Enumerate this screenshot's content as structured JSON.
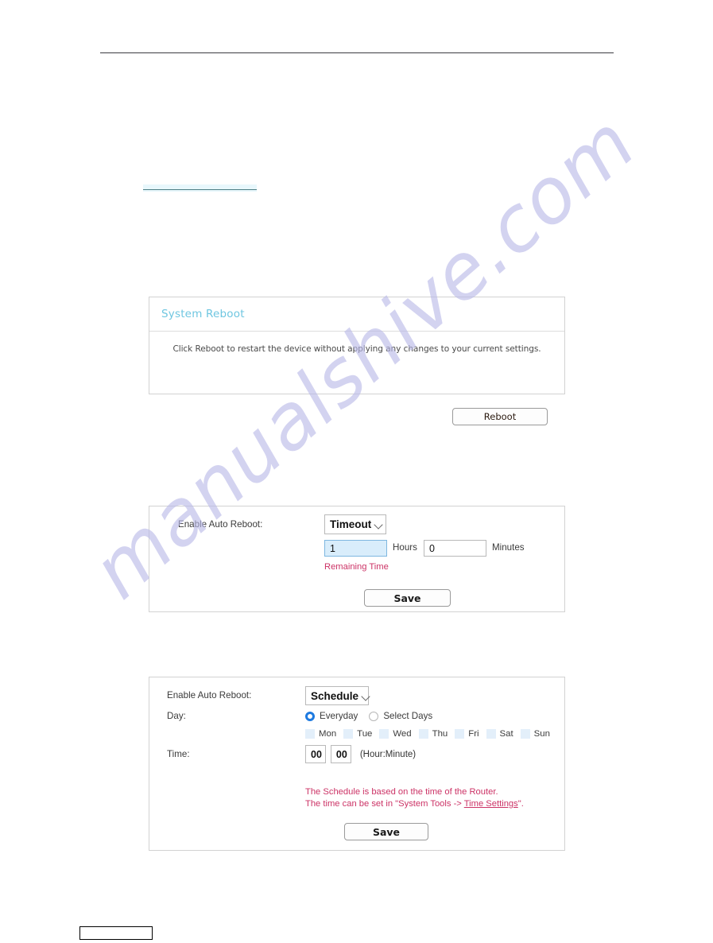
{
  "watermark": {
    "text": "manualshive.com"
  },
  "panels": {
    "system_reboot": {
      "title": "System Reboot",
      "description": "Click Reboot to restart the device without applying any changes to your current settings.",
      "reboot_button": "Reboot"
    },
    "auto_reboot_timeout": {
      "enable_label": "Enable Auto Reboot:",
      "mode": "Timeout",
      "hours_value": "1",
      "hours_unit": "Hours",
      "minutes_value": "0",
      "minutes_unit": "Minutes",
      "remaining_time": "Remaining Time",
      "save_button": "Save"
    },
    "auto_reboot_schedule": {
      "enable_label": "Enable Auto Reboot:",
      "mode": "Schedule",
      "day_label": "Day:",
      "everyday_label": "Everyday",
      "select_days_label": "Select Days",
      "selected_day_mode": "Everyday",
      "days": [
        {
          "label": "Mon",
          "checked": false
        },
        {
          "label": "Tue",
          "checked": false
        },
        {
          "label": "Wed",
          "checked": false
        },
        {
          "label": "Thu",
          "checked": false
        },
        {
          "label": "Fri",
          "checked": false
        },
        {
          "label": "Sat",
          "checked": false
        },
        {
          "label": "Sun",
          "checked": false
        }
      ],
      "time_label": "Time:",
      "hour_value": "00",
      "minute_value": "00",
      "hour_minute_note": "(Hour:Minute)",
      "hint_line_1": "The Schedule is based on the time of the Router.",
      "hint_line_2_prefix": "The time can be set in \"System Tools -> ",
      "hint_line_2_link": "Time Settings",
      "hint_line_2_suffix": "\".",
      "save_button": "Save"
    }
  },
  "colors": {
    "panel_title": "#6ec6e0",
    "hint_red": "#cc3366",
    "radio_selected": "#1e7ae0",
    "input_focus_bg": "#d9edfb",
    "watermark": "#b9b9e8"
  }
}
